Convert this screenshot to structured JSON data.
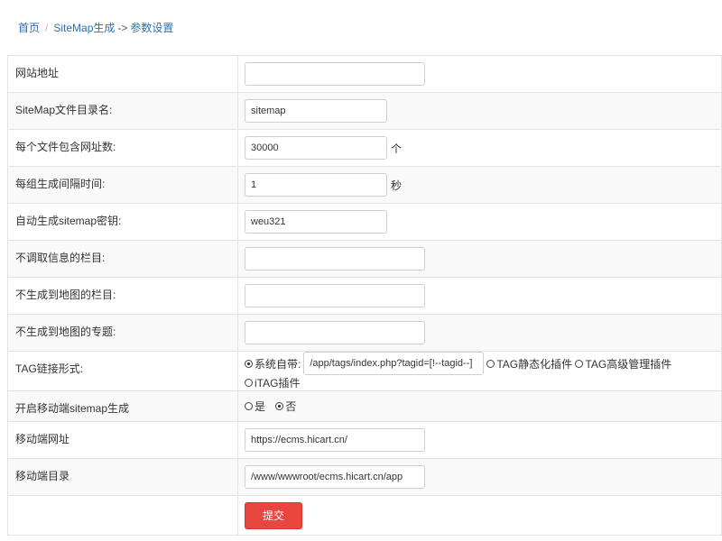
{
  "breadcrumb": {
    "home": "首页",
    "separator": "/",
    "module": "SiteMap生成",
    "arrow": "->",
    "current": "参数设置"
  },
  "form": {
    "site_url": {
      "label": "网站地址",
      "value": ""
    },
    "sitemap_dir": {
      "label": "SiteMap文件目录名:",
      "value": "sitemap"
    },
    "urls_per_file": {
      "label": "每个文件包含网址数:",
      "value": "30000",
      "unit": "个"
    },
    "interval": {
      "label": "每组生成间隔时间:",
      "value": "1",
      "unit": "秒"
    },
    "auto_key": {
      "label": "自动生成sitemap密钥:",
      "value": "weu321"
    },
    "exclude_columns": {
      "label": "不调取信息的栏目:",
      "value": ""
    },
    "exclude_map_columns": {
      "label": "不生成到地图的栏目:",
      "value": ""
    },
    "exclude_map_topics": {
      "label": "不生成到地图的专题:",
      "value": ""
    },
    "tag_link": {
      "label": "TAG链接形式:",
      "options": [
        {
          "label": "系统自带:",
          "checked": true
        },
        {
          "label": "TAG静态化插件",
          "checked": false
        },
        {
          "label": "TAG高级管理插件",
          "checked": false
        },
        {
          "label": "iTAG插件",
          "checked": false
        }
      ],
      "system_value": "/app/tags/index.php?tagid=[!--tagid--]"
    },
    "mobile_enable": {
      "label": "开启移动端sitemap生成",
      "options": [
        {
          "label": "是",
          "checked": false
        },
        {
          "label": "否",
          "checked": true
        }
      ]
    },
    "mobile_url": {
      "label": "移动端网址",
      "value": "https://ecms.hicart.cn/"
    },
    "mobile_dir": {
      "label": "移动端目录",
      "value": "/www/wwwroot/ecms.hicart.cn/app"
    },
    "submit_label": "提交"
  },
  "colors": {
    "link": "#2a6fb6",
    "submit": "#e9463f",
    "border": "#e3e3e3",
    "row_alt": "#f9f9f9"
  }
}
